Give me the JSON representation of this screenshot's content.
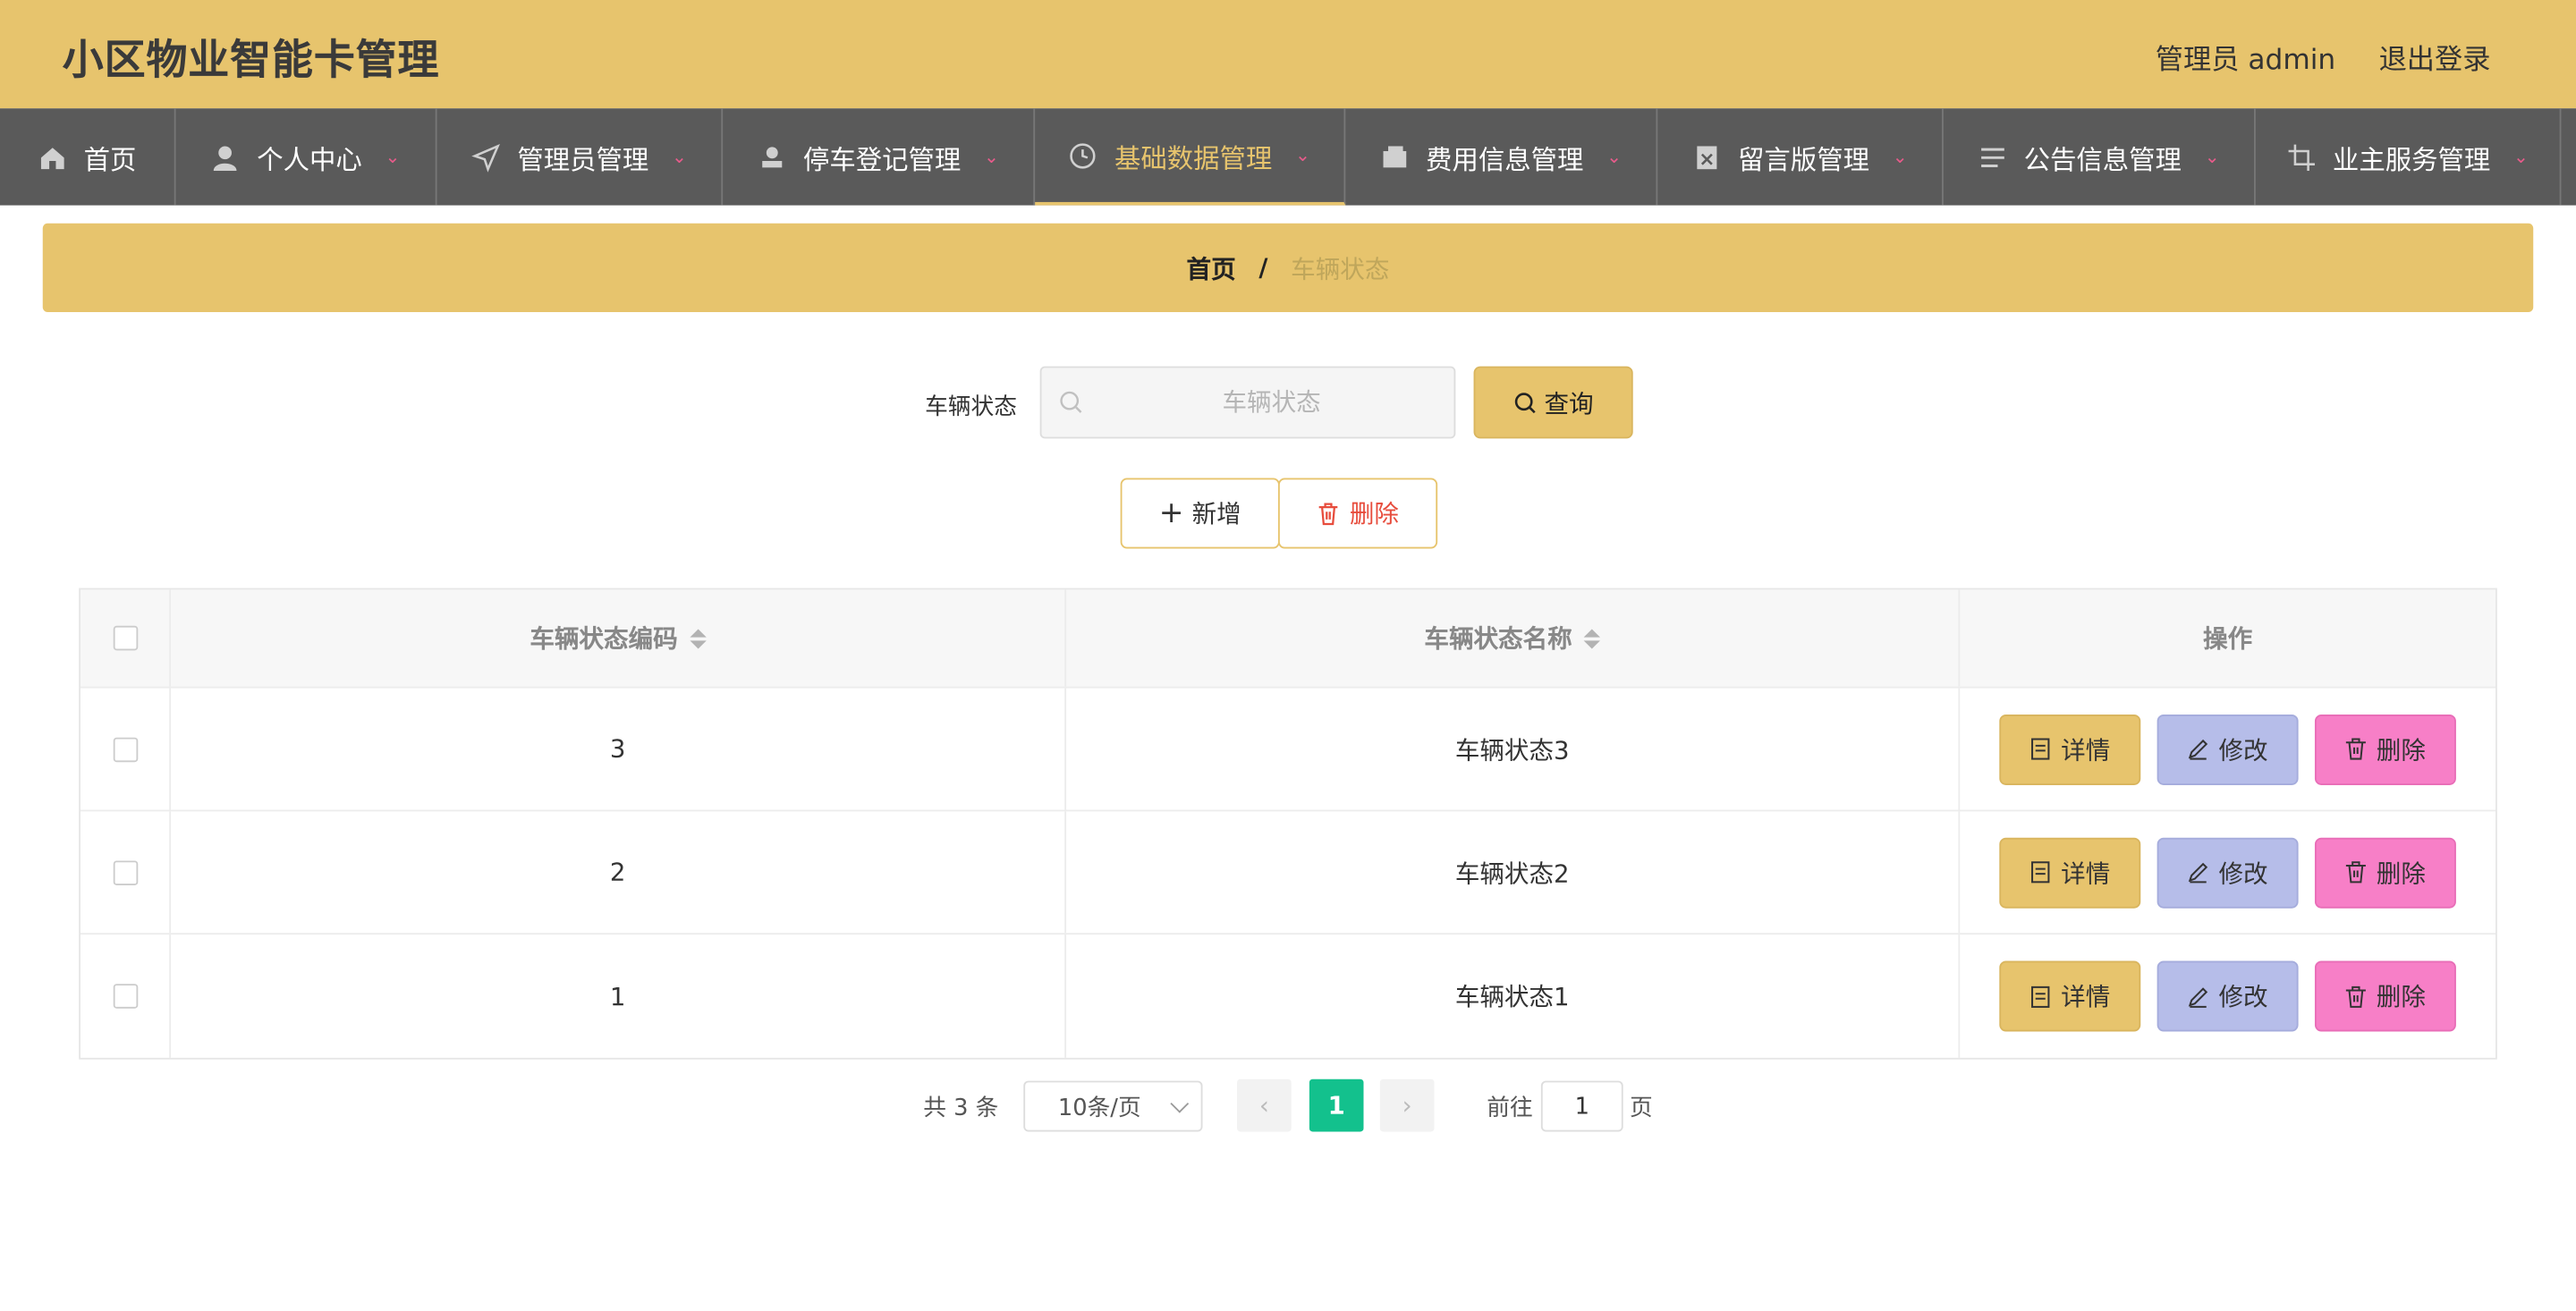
{
  "header": {
    "title": "小区物业智能卡管理",
    "user_label": "管理员 admin",
    "logout_label": "退出登录",
    "bg_color": "#e7c46d"
  },
  "nav": {
    "items": [
      {
        "label": "首页",
        "icon": "home-icon"
      },
      {
        "label": "个人中心",
        "icon": "user-icon"
      },
      {
        "label": "管理员管理",
        "icon": "send-icon"
      },
      {
        "label": "停车登记管理",
        "icon": "person-stamp-icon"
      },
      {
        "label": "基础数据管理",
        "icon": "clock-icon",
        "active": true
      },
      {
        "label": "费用信息管理",
        "icon": "wallet-icon"
      },
      {
        "label": "留言版管理",
        "icon": "clipboard-icon"
      },
      {
        "label": "公告信息管理",
        "icon": "list-icon"
      },
      {
        "label": "业主服务管理",
        "icon": "crop-icon"
      }
    ]
  },
  "breadcrumb": {
    "home": "首页",
    "separator": "/",
    "current": "车辆状态"
  },
  "search": {
    "label": "车辆状态",
    "placeholder": "车辆状态",
    "button_label": "查询"
  },
  "actions": {
    "add_label": "新增",
    "delete_label": "删除"
  },
  "table": {
    "columns": [
      "车辆状态编码",
      "车辆状态名称",
      "操作"
    ],
    "rows": [
      {
        "code": "3",
        "name": "车辆状态3"
      },
      {
        "code": "2",
        "name": "车辆状态2"
      },
      {
        "code": "1",
        "name": "车辆状态1"
      }
    ],
    "row_actions": {
      "detail": "详情",
      "edit": "修改",
      "delete": "删除"
    }
  },
  "pagination": {
    "total_text": "共 3 条",
    "page_size": "10条/页",
    "current_page": "1",
    "goto_label": "前往",
    "goto_value": "1",
    "goto_suffix": "页"
  },
  "colors": {
    "accent": "#e7c46d",
    "nav_bg": "#5a5a5a",
    "edit_btn": "#b6bde9",
    "delete_btn": "#f77fc7",
    "page_active": "#13c18d"
  }
}
